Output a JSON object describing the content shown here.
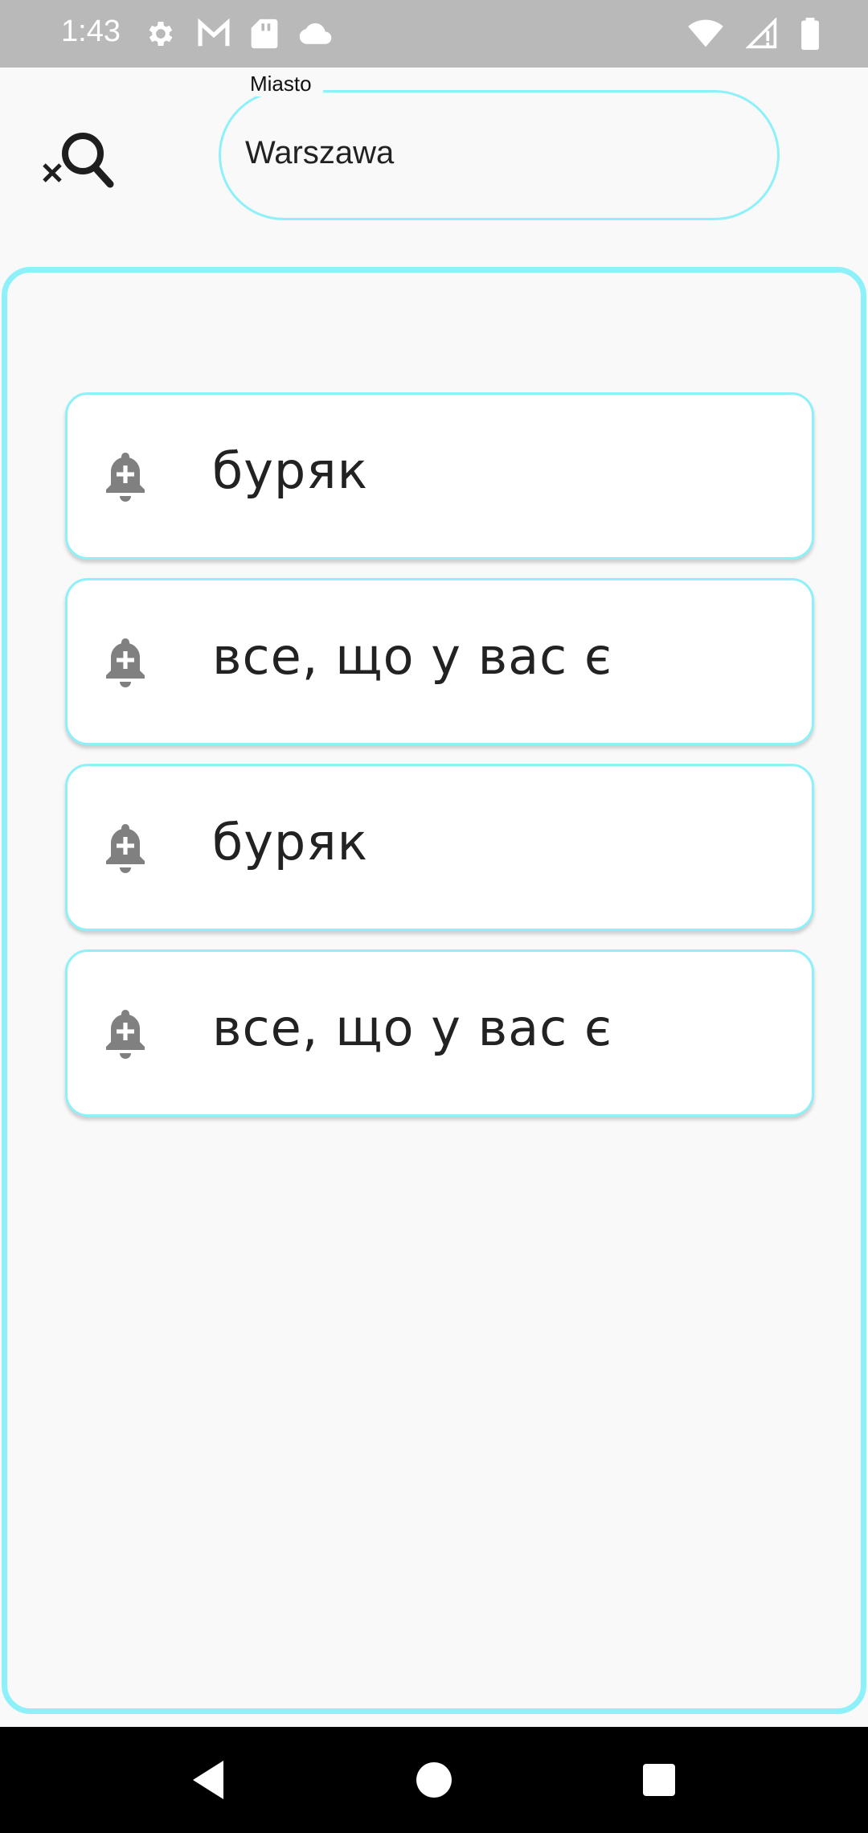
{
  "status_bar": {
    "time": "1:43",
    "left_icons": [
      "settings-icon",
      "gmail-icon",
      "sd-card-icon",
      "cloud-icon"
    ],
    "right_icons": [
      "wifi-icon",
      "signal-icon",
      "battery-icon"
    ]
  },
  "header": {
    "clear_search_icon": "clear-search-icon",
    "city_field": {
      "label": "Miasto",
      "value": "Warszawa"
    }
  },
  "items": [
    {
      "label": "буряк",
      "icon": "add-alert-icon"
    },
    {
      "label": "все, що у вас є",
      "icon": "add-alert-icon"
    },
    {
      "label": "буряк",
      "icon": "add-alert-icon"
    },
    {
      "label": "все, що у вас є",
      "icon": "add-alert-icon"
    }
  ],
  "colors": {
    "accent": "#8ef0f8",
    "status_bar": "#b9b9b9",
    "background": "#f9f9f9",
    "icon_gray": "#808080",
    "nav_bar": "#000000"
  },
  "nav_bar": [
    "back-icon",
    "home-icon",
    "recents-icon"
  ]
}
